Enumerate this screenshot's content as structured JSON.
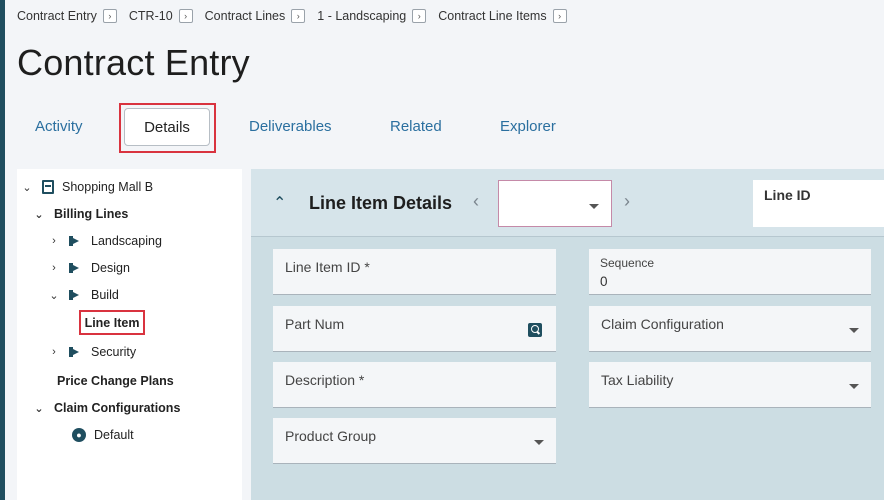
{
  "breadcrumb": [
    {
      "label": "Contract Entry"
    },
    {
      "label": "CTR-10"
    },
    {
      "label": "Contract Lines"
    },
    {
      "label": "1 - Landscaping"
    },
    {
      "label": "Contract Line Items"
    }
  ],
  "page_title": "Contract Entry",
  "tabs": {
    "activity": "Activity",
    "details": "Details",
    "deliverables": "Deliverables",
    "related": "Related",
    "explorer": "Explorer"
  },
  "tree": {
    "root": "Shopping Mall B",
    "billing_lines": "Billing Lines",
    "landscaping": "Landscaping",
    "design": "Design",
    "build": "Build",
    "line_item": "Line Item",
    "security": "Security",
    "price_change_plans": "Price Change Plans",
    "claim_configurations": "Claim Configurations",
    "default": "Default"
  },
  "detail": {
    "title": "Line Item Details",
    "line_id_label": "Line ID",
    "fields": {
      "line_item_id": "Line Item ID *",
      "sequence_label": "Sequence",
      "sequence_value": "0",
      "part_num": "Part Num",
      "claim_configuration": "Claim Configuration",
      "description": "Description *",
      "tax_liability": "Tax Liability",
      "product_group": "Product Group"
    }
  },
  "colors": {
    "accent": "#1f4e5f",
    "link": "#2a6f9f",
    "highlight": "#d9333f",
    "detail_bg": "#ccdde3"
  }
}
